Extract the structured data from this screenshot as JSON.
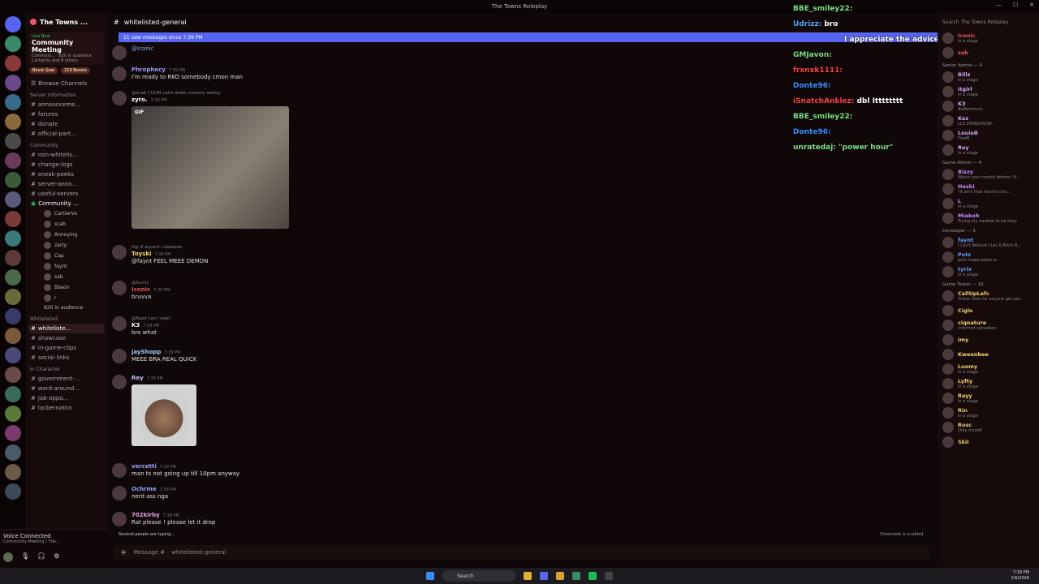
{
  "window": {
    "title": "The Towns Roleplay"
  },
  "server": {
    "name": "The Towns ...",
    "boost_goal": "Boost Goal",
    "boosts": "219 Boosts"
  },
  "live": {
    "label": "Live Now",
    "title": "Community Meeting",
    "meta": "Communi... · 820 in audience",
    "others": "CartierVx and 8 others"
  },
  "channels": {
    "browse": "Browse Channels",
    "cat_server_info": "Server Information",
    "server_info": [
      "announceme...",
      "forums",
      "donate",
      "official-part..."
    ],
    "cat_community": "Community",
    "community": [
      "non-whitelis...",
      "change-logs",
      "sneak-peeks",
      "server-anno...",
      "useful-servers"
    ],
    "stage_name": "Community ...",
    "stage_sub": "Community Meeting",
    "stage_users": [
      "CartierVx",
      "scab",
      "Annoying",
      "zarty",
      "Cap",
      "faynt",
      "sab",
      "Blaxin",
      "r"
    ],
    "audience": "820 in audience",
    "cat_whitelisted": "Whitelisted",
    "whitelisted": [
      "whiteliste...",
      "showcase",
      "in-game-clips",
      "social-links"
    ],
    "cat_in_character": "In Character",
    "in_character": [
      "government-...",
      "word-around...",
      "job-oppo...",
      "lacbernaton"
    ]
  },
  "voice": {
    "status": "Voice Connected",
    "sub": "Community Meeting / The..."
  },
  "main": {
    "channel_name": "whitelisted-general",
    "new_messages": "11 new messages since 7:39 PM",
    "messages": [
      {
        "reply": "",
        "name": "",
        "time": "",
        "text": "@Iconic",
        "color": "#8ab4ff"
      },
      {
        "reply": "",
        "name": "Phrophecy",
        "time": "7:39 PM",
        "text": "I'm ready to RKO somebody cmon man",
        "color": "#9aa0ff"
      },
      {
        "reply": "@scab CUUM calm down creamy reemy",
        "name": "zyro.",
        "time": "7:39 PM",
        "text": "",
        "color": "#ffffff"
      },
      {
        "reply": "fsg lil accent cuteeeee",
        "name": "Toyski",
        "time": "7:39 PM",
        "text": "@faynt FEEL MEEE DEMON",
        "color": "#f5d36a"
      },
      {
        "reply": "@Iconic",
        "name": "Iconic",
        "time": "7:39 PM",
        "text": "bruvva",
        "color": "#e05a5a"
      },
      {
        "reply": "@Nazz can I eyp?",
        "name": "K3",
        "time": "7:39 PM",
        "text": "bro what",
        "color": "#ffffff"
      },
      {
        "reply": "",
        "name": "jayShopp",
        "time": "7:39 PM",
        "text": "MEEE BRA REAL QUICK",
        "color": "#9ad0ff"
      },
      {
        "reply": "",
        "name": "Rey",
        "time": "7:39 PM",
        "text": "",
        "color": "#b9c4ff"
      },
      {
        "reply": "",
        "name": "vercetti",
        "time": "7:39 PM",
        "text": "man ts not going up till 10pm anyway",
        "color": "#9aa0ff"
      },
      {
        "reply": "",
        "name": "Ochrme",
        "time": "7:39 PM",
        "text": "nerd ass nga",
        "color": "#9aa0ff"
      },
      {
        "reply": "",
        "name": "702kirby",
        "time": "7:39 PM",
        "text": "Rat please ! please let it drop",
        "color": "#e8a0e8"
      }
    ],
    "gif_label": "GIF",
    "typing": "Several people are typing...",
    "slowmode": "Slowmode is enabled.",
    "composer_placeholder": "Message #",
    "composer_channel": "whitelisted-general"
  },
  "overlay": [
    {
      "name": "BBE_smiley22:",
      "text": "",
      "color": "#7ee07e"
    },
    {
      "name": "Udrizz:",
      "text": "bro",
      "color": "#4fa8ff"
    },
    {
      "name": "",
      "text": "I appreciate the advice Stacy I went and took shit",
      "color": "#ffffff"
    },
    {
      "name": "GMJavon:",
      "text": "",
      "color": "#7ee07e"
    },
    {
      "name": "frxnxk1111:",
      "text": "",
      "color": "#ff4040"
    },
    {
      "name": "Donte96:",
      "text": "",
      "color": "#3d8bff"
    },
    {
      "name": "iSnatchAnklez:",
      "text": "dbl Itttttttt",
      "color": "#ff4040"
    },
    {
      "name": "BBE_smiley22:",
      "text": "",
      "color": "#7ee07e"
    },
    {
      "name": "Donte96:",
      "text": "",
      "color": "#3d8bff"
    },
    {
      "name": "unratedaj:",
      "text": "\"power hour\"",
      "color": "#7ee07e"
    }
  ],
  "members": {
    "search_placeholder": "Search The Towns Roleplay",
    "groups": [
      {
        "role": "",
        "members": [
          {
            "n": "Iconic",
            "s": "In a stage",
            "c": "#e05a5a"
          },
          {
            "n": "sab",
            "s": "",
            "c": "#e05a5a"
          }
        ]
      },
      {
        "role": "Senior Admin — 6",
        "members": [
          {
            "n": "Billz",
            "s": "In a stage",
            "c": "#d9a0ff"
          },
          {
            "n": "itgirl",
            "s": "In a stage",
            "c": "#d9a0ff"
          },
          {
            "n": "K3",
            "s": "#afterhours.",
            "c": "#d9a0ff"
          },
          {
            "n": "Kez",
            "s": "LLS STAND4SUM.",
            "c": "#d9a0ff"
          },
          {
            "n": "LouieB",
            "s": "FiveM",
            "c": "#d9a0ff"
          },
          {
            "n": "Rey",
            "s": "In a stage",
            "c": "#d9a0ff"
          }
        ]
      },
      {
        "role": "Game Admin — 4",
        "members": [
          {
            "n": "Bizzy",
            "s": "Watch your mouth before I fi...",
            "c": "#c48aff"
          },
          {
            "n": "Hashi",
            "s": "\"It ain't that hard to cho...",
            "c": "#c48aff"
          },
          {
            "n": "L",
            "s": "In a stage",
            "c": "#c48aff"
          },
          {
            "n": "Miekoh",
            "s": "Trying my hardest to be okay",
            "c": "#c48aff"
          }
        ]
      },
      {
        "role": "Developer — 3",
        "members": [
          {
            "n": "faynt",
            "s": "I Can't Believe I Let A Bitch N...",
            "c": "#5aa0ff"
          },
          {
            "n": "Polo",
            "s": "polo-maps.tebex.io",
            "c": "#5aa0ff"
          },
          {
            "n": "tyrix",
            "s": "In a stage",
            "c": "#5aa0ff"
          }
        ]
      },
      {
        "role": "Game Tester — 16",
        "members": [
          {
            "n": "CallUpLefc",
            "s": "These hoes for anyone get you",
            "c": "#f5d36a"
          },
          {
            "n": "Ciglo",
            "s": "",
            "c": "#f5d36a"
          },
          {
            "n": "ciqnature",
            "s": "interrnet sensation",
            "c": "#f5d36a"
          },
          {
            "n": "imy",
            "s": "",
            "c": "#f5d36a"
          },
          {
            "n": "Kweenbee",
            "s": "",
            "c": "#f5d36a"
          },
          {
            "n": "Loomy",
            "s": "In a stage",
            "c": "#f5d36a"
          },
          {
            "n": "Lyfty",
            "s": "In a stage",
            "c": "#f5d36a"
          },
          {
            "n": "Rayy",
            "s": "In a stage",
            "c": "#f5d36a"
          },
          {
            "n": "Rin",
            "s": "In a stage",
            "c": "#f5d36a"
          },
          {
            "n": "Rosc",
            "s": "Only myself",
            "c": "#f5d36a"
          },
          {
            "n": "Skii",
            "s": "",
            "c": "#f5d36a"
          }
        ]
      }
    ]
  },
  "taskbar": {
    "search": "Search",
    "time": "7:39 PM",
    "date": "2/6/2026"
  }
}
